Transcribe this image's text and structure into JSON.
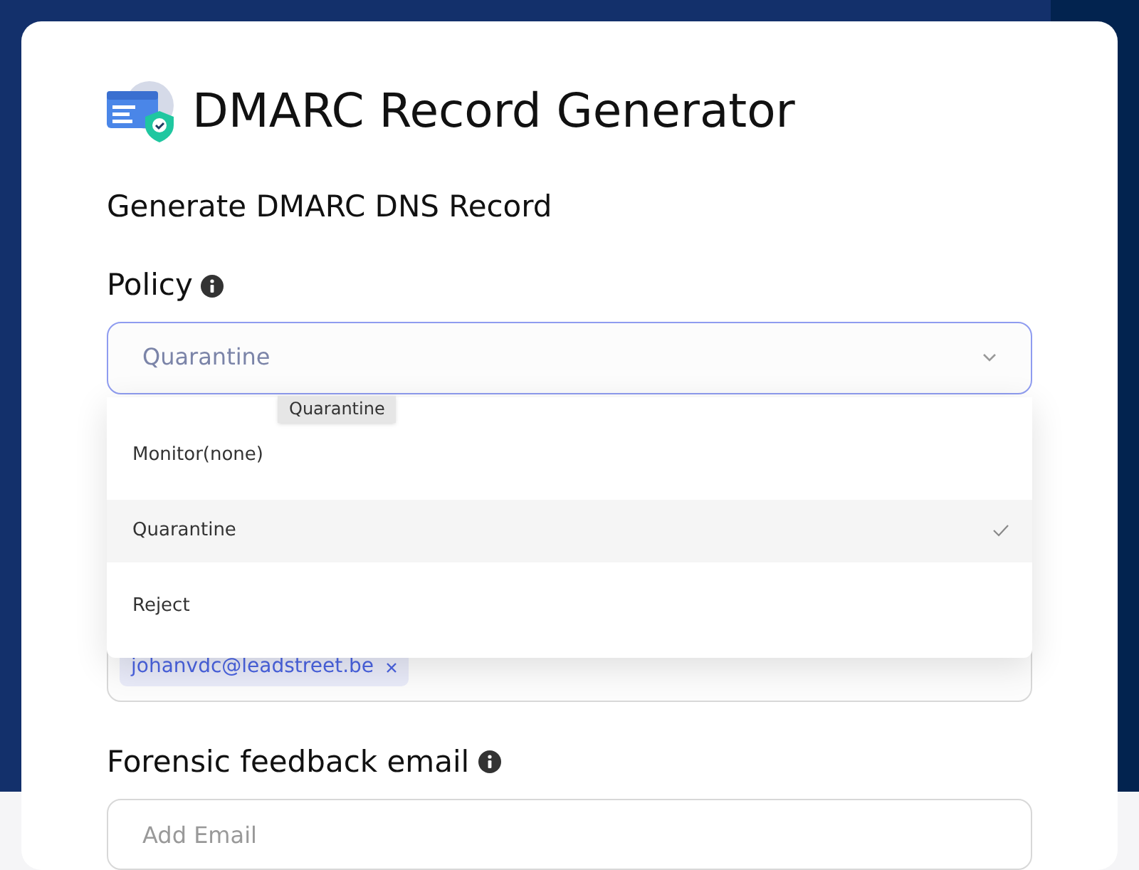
{
  "header": {
    "title": "DMARC Record Generator",
    "subtitle": "Generate DMARC DNS Record"
  },
  "policy": {
    "label": "Policy",
    "value": "Quarantine",
    "expanded": true,
    "options": [
      {
        "label": "Monitor(none)",
        "selected": false
      },
      {
        "label": "Quarantine",
        "selected": true
      },
      {
        "label": "Reject",
        "selected": false
      }
    ],
    "tooltip": "Quarantine"
  },
  "aggregate_email": {
    "chips": [
      "johanvdc@leadstreet.be"
    ]
  },
  "forensic_email": {
    "label": "Forensic feedback email",
    "placeholder": "Add Email"
  }
}
